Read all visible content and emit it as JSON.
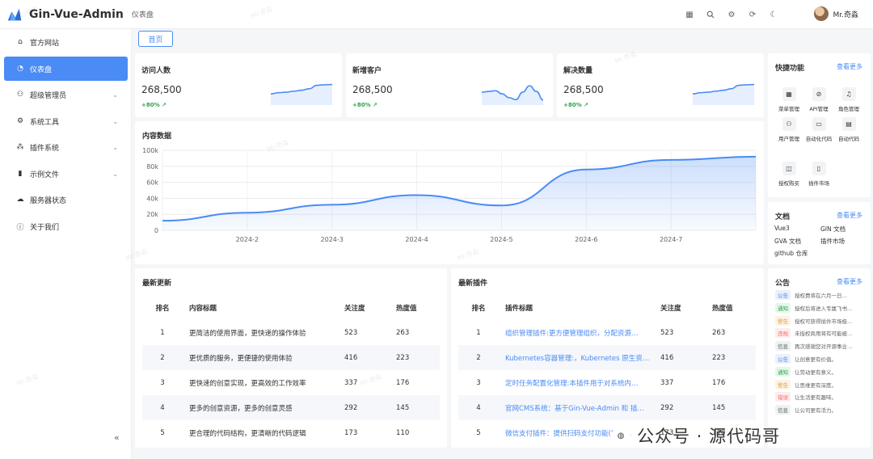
{
  "header": {
    "app_title": "Gin-Vue-Admin",
    "breadcrumb": "仪表盘",
    "user_name": "Mr.奇淼",
    "tools": [
      "layout-icon",
      "search-icon",
      "settings-icon",
      "refresh-icon",
      "moon-icon"
    ]
  },
  "sidebar": {
    "items": [
      {
        "label": "官方网站",
        "icon": "home-icon",
        "expandable": false
      },
      {
        "label": "仪表盘",
        "icon": "dashboard-icon",
        "expandable": false
      },
      {
        "label": "超级管理员",
        "icon": "user-icon",
        "expandable": true
      },
      {
        "label": "系统工具",
        "icon": "gear-icon",
        "expandable": true
      },
      {
        "label": "插件系统",
        "icon": "plugin-icon",
        "expandable": true
      },
      {
        "label": "示例文件",
        "icon": "library-icon",
        "expandable": true
      },
      {
        "label": "服务器状态",
        "icon": "cloud-icon",
        "expandable": false
      },
      {
        "label": "关于我们",
        "icon": "info-icon",
        "expandable": false
      }
    ],
    "collapse_glyph": "«"
  },
  "tabs": [
    {
      "label": "首页"
    }
  ],
  "stats": [
    {
      "title": "访问人数",
      "value": "268,500",
      "delta": "+80%",
      "trend": [
        0.45,
        0.5,
        0.52,
        0.56,
        0.6,
        0.66,
        0.8,
        0.82,
        0.83
      ]
    },
    {
      "title": "新增客户",
      "value": "268,500",
      "delta": "+80%",
      "trend": [
        0.52,
        0.55,
        0.58,
        0.45,
        0.3,
        0.22,
        0.52,
        0.78,
        0.55,
        0.2
      ]
    },
    {
      "title": "解决数量",
      "value": "268,500",
      "delta": "+80%",
      "trend": [
        0.45,
        0.5,
        0.52,
        0.56,
        0.6,
        0.66,
        0.8,
        0.82,
        0.83
      ]
    }
  ],
  "content_chart": {
    "title": "内容数据"
  },
  "chart_data": {
    "type": "area",
    "title": "内容数据",
    "categories": [
      "2024-2",
      "2024-3",
      "2024-4",
      "2024-5",
      "2024-6",
      "2024-7"
    ],
    "x": [
      0,
      1,
      2,
      3,
      4,
      5,
      6,
      7
    ],
    "x_labels": [
      "",
      "2024-2",
      "2024-3",
      "2024-4",
      "2024-5",
      "2024-6",
      "2024-7",
      ""
    ],
    "values": [
      12,
      22,
      32,
      44,
      31,
      76,
      88,
      92
    ],
    "yticks": [
      "0",
      "20k",
      "40k",
      "60k",
      "80k",
      "100k"
    ],
    "ylim": [
      0,
      100
    ],
    "grid": true,
    "color": "#4a8bf5"
  },
  "updates": {
    "title": "最新更新",
    "columns": [
      "排名",
      "内容标题",
      "关注度",
      "热度值"
    ],
    "rows": [
      {
        "rank": "1",
        "title": "更简洁的使用界面，更快速的操作体验",
        "follow": "523",
        "hot": "263"
      },
      {
        "rank": "2",
        "title": "更优质的服务，更便捷的使用体验",
        "follow": "416",
        "hot": "223"
      },
      {
        "rank": "3",
        "title": "更快速的创意实现，更高效的工作效率",
        "follow": "337",
        "hot": "176"
      },
      {
        "rank": "4",
        "title": "更多的创意资源，更多的创意灵感",
        "follow": "292",
        "hot": "145"
      },
      {
        "rank": "5",
        "title": "更合理的代码结构，更清晰的代码逻辑",
        "follow": "173",
        "hot": "110"
      }
    ]
  },
  "plugins": {
    "title": "最新插件",
    "columns": [
      "排名",
      "插件标题",
      "关注度",
      "热度值"
    ],
    "rows": [
      {
        "rank": "1",
        "title": "组织管理插件:更方便管理组织，分配资源…",
        "follow": "523",
        "hot": "263"
      },
      {
        "rank": "2",
        "title": "Kubernetes容器管理:，Kubernetes 原生资…",
        "follow": "416",
        "hot": "223"
      },
      {
        "rank": "3",
        "title": "定时任务配置化管理:本插件用于对系统内…",
        "follow": "337",
        "hot": "176"
      },
      {
        "rank": "4",
        "title": "官网CMS系统：基于Gin-Vue-Admin 和 插…",
        "follow": "292",
        "hot": "145"
      },
      {
        "rank": "5",
        "title": "微信支付插件：提供扫码支付功能(需自…",
        "follow": "173",
        "hot": "110"
      }
    ]
  },
  "quick": {
    "title": "快捷功能",
    "more": "查看更多",
    "items": [
      {
        "label": "菜单管理",
        "icon": "grid-icon"
      },
      {
        "label": "API管理",
        "icon": "link-icon"
      },
      {
        "label": "角色管理",
        "icon": "headset-icon"
      },
      {
        "label": "用户管理",
        "icon": "user-icon"
      },
      {
        "label": "自动化代码",
        "icon": "box-icon"
      },
      {
        "label": "自动代码",
        "icon": "doc-icon"
      },
      {
        "label": "授权购买",
        "icon": "book-icon"
      },
      {
        "label": "插件市场",
        "icon": "file-icon"
      }
    ]
  },
  "docs": {
    "title": "文档",
    "more": "查看更多",
    "items": [
      "Vue3",
      "GIN 文档",
      "GVA 文档",
      "插件市场",
      "github 仓库"
    ]
  },
  "notices": {
    "title": "公告",
    "more": "查看更多",
    "items": [
      {
        "type": "公告",
        "text": "授权费将在六月一日…",
        "fg": "#4a8bf5",
        "bg": "#e8f1fe"
      },
      {
        "type": "通知",
        "text": "授权后将进入专属飞书…",
        "fg": "#2ea44f",
        "bg": "#e7f6ec"
      },
      {
        "type": "警告",
        "text": "授权可获得插件市场极…",
        "fg": "#e6a23c",
        "bg": "#fdf3e4"
      },
      {
        "type": "违规",
        "text": "未授权商用将有可能被…",
        "fg": "#f56c6c",
        "bg": "#fdecec"
      },
      {
        "type": "信息",
        "text": "再次感谢您对开源事业…",
        "fg": "#606266",
        "bg": "#f0f1f3"
      },
      {
        "type": "公告",
        "text": "让创意更有价值。",
        "fg": "#4a8bf5",
        "bg": "#e8f1fe"
      },
      {
        "type": "通知",
        "text": "让劳动更有意义。",
        "fg": "#2ea44f",
        "bg": "#e7f6ec"
      },
      {
        "type": "警告",
        "text": "让思维更有深度。",
        "fg": "#e6a23c",
        "bg": "#fdf3e4"
      },
      {
        "type": "错误",
        "text": "让生活更有趣味。",
        "fg": "#f56c6c",
        "bg": "#fdecec"
      },
      {
        "type": "信息",
        "text": "让公司更有活力。",
        "fg": "#606266",
        "bg": "#f0f1f3"
      }
    ]
  },
  "overlay": {
    "watermark": "Mr.奇淼",
    "social_text": "公众号 · 源代码哥"
  }
}
